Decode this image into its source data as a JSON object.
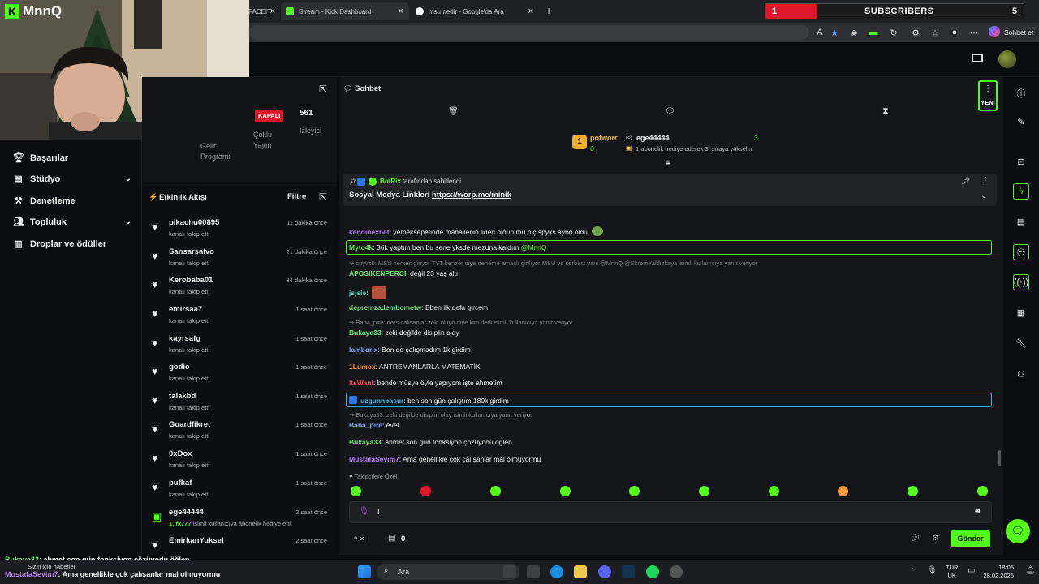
{
  "browser": {
    "tabs": [
      {
        "label": "FACEIT"
      },
      {
        "label": "Stream - Kick Dashboard"
      },
      {
        "label": "msu nedir - Google'da Ara"
      }
    ],
    "profile_label": "Sohbet et"
  },
  "overlay": {
    "logo": "MnnQ",
    "sub_count": "1",
    "sub_label": "SUBSCRIBERS",
    "sub_right_count": "5"
  },
  "sidebar": {
    "items": [
      {
        "label": "Başarılar",
        "icon": "trophy-icon"
      },
      {
        "label": "Stüdyo",
        "icon": "studio-icon"
      },
      {
        "label": "Denetleme",
        "icon": "hammer-icon"
      },
      {
        "label": "Topluluk",
        "icon": "community-icon"
      },
      {
        "label": "Droplar ve ödüller",
        "icon": "drops-icon"
      }
    ]
  },
  "stats": {
    "status_badge": "KAPALI",
    "viewers_count": "561",
    "viewers_label": "İzleyici",
    "multi_stream": "Çoklu Yayın",
    "income_program": "Gelir Programı"
  },
  "feed": {
    "title": "Etkinlik Akışı",
    "filter": "Filtre",
    "rows": [
      {
        "name": "pikachu00895",
        "sub": "kanalı takip etti",
        "time": "11 dakika önce",
        "type": "follow"
      },
      {
        "name": "Sansarsalvo",
        "sub": "kanalı takip etti",
        "time": "21 dakika önce",
        "type": "follow"
      },
      {
        "name": "Kerobaba01",
        "sub": "kanalı takip etti",
        "time": "34 dakika önce",
        "type": "follow"
      },
      {
        "name": "emirsaa7",
        "sub": "kanalı takip etti",
        "time": "1 saat önce",
        "type": "follow"
      },
      {
        "name": "kayrsafg",
        "sub": "kanalı takip etti",
        "time": "1 saat önce",
        "type": "follow"
      },
      {
        "name": "godic",
        "sub": "kanalı takip etti",
        "time": "1 saat önce",
        "type": "follow"
      },
      {
        "name": "talakbd",
        "sub": "kanalı takip etti",
        "time": "1 saat önce",
        "type": "follow"
      },
      {
        "name": "Guardfikret",
        "sub": "kanalı takip etti",
        "time": "1 saat önce",
        "type": "follow"
      },
      {
        "name": "0xDox",
        "sub": "kanalı takip etti",
        "time": "1 saat önce",
        "type": "follow"
      },
      {
        "name": "pufkaf",
        "sub": "kanalı takip etti",
        "time": "1 saat önce",
        "type": "follow"
      },
      {
        "name": "ege44444",
        "sub_user": "1, fk777",
        "sub": "isimli kullanıcıya abonelik hediye etti.",
        "time": "2 saat önce",
        "type": "gift"
      },
      {
        "name": "EmirkanYuksel",
        "sub": "",
        "time": "2 saat önce",
        "type": "follow"
      }
    ]
  },
  "chat": {
    "title": "Sohbet",
    "new_label": "YENİ",
    "leaderboard": {
      "rank": "1",
      "first_name": "potworr",
      "first_count": "6",
      "second_name": "ege44444",
      "second_count": "3",
      "second_desc": "1 abonelik hediye ederek 3. sıraya yükselin"
    },
    "pinned": {
      "by_user": "BotRix",
      "by_suffix": "tarafından sabitlendi",
      "text": "Sosyal Medya Linkleri",
      "link": "https://worp.me/minik"
    },
    "messages": [
      {
        "user": "kendinexbet",
        "color": "#b77cf2",
        "text": "yemeksepetinde mahallenin lideri oldun mu hiç spyks aybo oldu"
      },
      {
        "user": "Myto4k",
        "color": "#5ee86b",
        "text": "36k yaptım ben bu sene yksde mezuna kaldım",
        "mention": "@MnnQ"
      },
      {
        "reply": "cnyvs0: MSÜ herkes giriyor TYT benzer diye deneme amaçlı girlliyor MSÜ ye serbest yani @MnnQ @EkremYaldizkaya isimli kullanıcıya yanıt veriyor"
      },
      {
        "user": "APOSIKENPERCI",
        "color": "#5ee86b",
        "text": "değil 23 yaş altı"
      },
      {
        "user": "jsjsie",
        "color": "#2fd3b5",
        "text": ""
      },
      {
        "user": "depremzadembometw",
        "color": "#5ee86b",
        "text": "Bben ilk defa gircem"
      },
      {
        "reply": "Baba_pire: ders calisanlar zeki oluyo diye kim dedi isimli kullanıcıya yanıt veriyor"
      },
      {
        "user": "Bukaya33",
        "color": "#5ee86b",
        "text": "zeki değilde disiplin olay"
      },
      {
        "user": "lamborix",
        "color": "#7aa6f7",
        "text": "Ben de çalışmadım 1k girdim"
      },
      {
        "user": "1Lumox",
        "color": "#f29a3e",
        "text": "ANTREMANLARLA MATEMATİK"
      },
      {
        "user": "ItsWani",
        "color": "#ef3f5a",
        "text": "bende müsye öyle yapıyom işte ahmetim"
      },
      {
        "user": "uzgunnbasur",
        "color": "#39b4ea",
        "text": "ben son gün çalıştım 180k girdim"
      },
      {
        "reply": "Bukaya33: zeki değilde disiplin olay isimli kullanıcıya yanıt veriyor"
      },
      {
        "user": "Baba_pire",
        "color": "#7aa6f7",
        "text": "evet"
      },
      {
        "user": "Bukaya33",
        "color": "#5ee86b",
        "text": "ahmet son gün fonksiyon çözüyodu öğlen"
      },
      {
        "user": "MustafaSevim7",
        "color": "#b77cf2",
        "text": "Ama genellikle çok çalışanlar mal olmuyormu"
      }
    ],
    "followers_only": "Takipçilere Özel",
    "input_value": "!",
    "bottom_count": "0",
    "send_label": "Gönder"
  },
  "overlay_chat": [
    {
      "user": "Bukaya33",
      "text": ": ahmet son gün fonksiyon çözüyodu öğlen"
    },
    {
      "user": "MustafaSevim7",
      "text": ": Ama genellikle çok çalışanlar mal olmuyormu"
    }
  ],
  "taskbar": {
    "search": "Ara",
    "news": "Sizin için haberler",
    "lang_top": "TUR",
    "lang_bottom": "UK",
    "time": "18:05",
    "date": "28.02.2026"
  },
  "colors": {
    "kick_green": "#53fc18",
    "live_red": "#e0162b"
  }
}
